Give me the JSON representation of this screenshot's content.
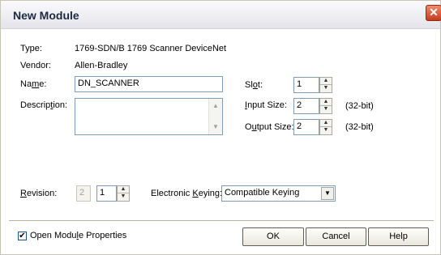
{
  "window": {
    "title": "New Module",
    "close_glyph": "✕"
  },
  "info": {
    "type_label": "Type:",
    "type_value": "1769-SDN/B 1769 Scanner DeviceNet",
    "vendor_label": "Vendor:",
    "vendor_value": "Allen-Bradley"
  },
  "form": {
    "name_label_pre": "Na",
    "name_label_u": "m",
    "name_label_post": "e:",
    "name_value": "DN_SCANNER",
    "description_label_pre": "Descrip",
    "description_label_u": "t",
    "description_label_post": "ion:",
    "description_value": "",
    "slot_label_pre": "Sl",
    "slot_label_u": "o",
    "slot_label_post": "t:",
    "slot_value": "1",
    "input_size_label_pre": "",
    "input_size_label_u": "I",
    "input_size_label_post": "nput Size:",
    "input_size_value": "2",
    "input_size_unit": "(32-bit)",
    "output_size_label_pre": "O",
    "output_size_label_u": "u",
    "output_size_label_post": "tput Size:",
    "output_size_value": "2",
    "output_size_unit": "(32-bit)",
    "revision_label_pre": "",
    "revision_label_u": "R",
    "revision_label_post": "evision:",
    "revision_major": "2",
    "revision_minor": "1",
    "keying_label_pre": "Electronic ",
    "keying_label_u": "K",
    "keying_label_post": "eying:",
    "keying_value": "Compatible Keying"
  },
  "footer": {
    "open_props_checked": true,
    "open_props_label_pre": "Open Modu",
    "open_props_label_u": "l",
    "open_props_label_post": "e Properties",
    "ok_label": "OK",
    "cancel_label": "Cancel",
    "help_label": "Help"
  },
  "icons": {
    "spin_up": "▲",
    "spin_down": "▼",
    "scroll_up": "▲",
    "scroll_down": "▼",
    "dropdown": "▼",
    "check": "✔"
  }
}
